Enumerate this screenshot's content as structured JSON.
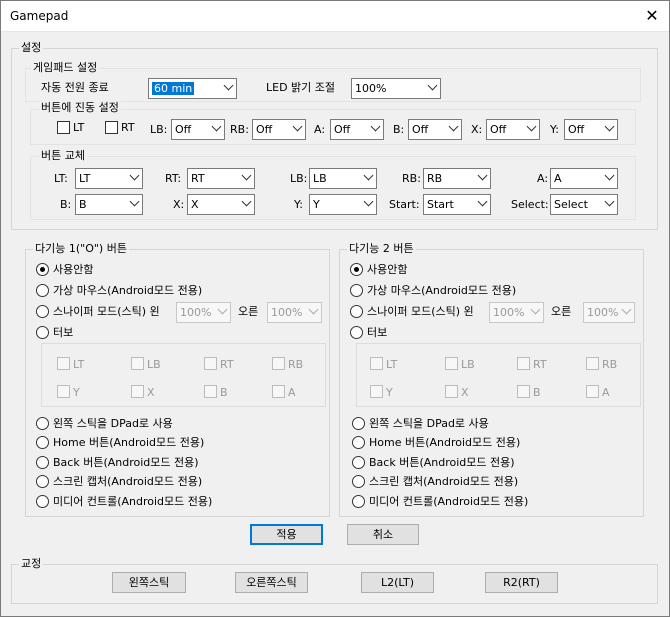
{
  "window": {
    "title": "Gamepad",
    "close_glyph": "✕"
  },
  "settings": {
    "legend": "설정",
    "gamepad": {
      "legend": "게임패드 설정",
      "auto_off_label": "자동 전원 종료",
      "auto_off_value": "60 min",
      "led_label": "LED 밝기 조절",
      "led_value": "100%"
    },
    "vibration": {
      "legend": "버튼에 진동 설정",
      "lt": "LT",
      "rt": "RT",
      "items": [
        {
          "label": "LB:",
          "value": "Off"
        },
        {
          "label": "RB:",
          "value": "Off"
        },
        {
          "label": "A:",
          "value": "Off"
        },
        {
          "label": "B:",
          "value": "Off"
        },
        {
          "label": "X:",
          "value": "Off"
        },
        {
          "label": "Y:",
          "value": "Off"
        }
      ]
    },
    "swap": {
      "legend": "버튼 교체",
      "row1": [
        {
          "label": "LT:",
          "value": "LT"
        },
        {
          "label": "RT:",
          "value": "RT"
        },
        {
          "label": "LB:",
          "value": "LB"
        },
        {
          "label": "RB:",
          "value": "RB"
        },
        {
          "label": "A:",
          "value": "A"
        }
      ],
      "row2": [
        {
          "label": "B:",
          "value": "B"
        },
        {
          "label": "X:",
          "value": "X"
        },
        {
          "label": "Y:",
          "value": "Y"
        },
        {
          "label": "Start:",
          "value": "Start"
        },
        {
          "label": "Select:",
          "value": "Select"
        }
      ]
    }
  },
  "multi1": {
    "legend": "다기능 1(\"O\") 버튼",
    "opt_none": "사용안함",
    "opt_mouse": "가상 마우스(Android모드 전용)",
    "opt_sniper": "스나이퍼 모드(스틱) 왼",
    "sniper_left": "100%",
    "sniper_right_label": "오른",
    "sniper_right": "100%",
    "opt_turbo": "터보",
    "turbo": [
      "LT",
      "LB",
      "RT",
      "RB",
      "Y",
      "X",
      "B",
      "A"
    ],
    "opt_dpad": "왼쪽 스틱을 DPad로 사용",
    "opt_home": "Home 버튼(Android모드 전용)",
    "opt_back": "Back 버튼(Android모드 전용)",
    "opt_capture": "스크린 캡처(Android모드 전용)",
    "opt_media": "미디어 컨트롤(Android모드 전용)"
  },
  "multi2": {
    "legend": "다기능 2 버튼",
    "opt_none": "사용안함",
    "opt_mouse": "가상 마우스(Android모드 전용)",
    "opt_sniper": "스나이퍼 모드(스틱) 왼",
    "sniper_left": "100%",
    "sniper_right_label": "오른",
    "sniper_right": "100%",
    "opt_turbo": "터보",
    "turbo": [
      "LT",
      "LB",
      "RT",
      "RB",
      "Y",
      "X",
      "B",
      "A"
    ],
    "opt_dpad": "왼쪽 스틱을 DPad로 사용",
    "opt_home": "Home 버튼(Android모드 전용)",
    "opt_back": "Back 버튼(Android모드 전용)",
    "opt_capture": "스크린 캡처(Android모드 전용)",
    "opt_media": "미디어 컨트롤(Android모드 전용)"
  },
  "actions": {
    "apply": "적용",
    "cancel": "취소"
  },
  "calibration": {
    "legend": "교정",
    "left_stick": "왼쪽스틱",
    "right_stick": "오른쪽스틱",
    "l2": "L2(LT)",
    "r2": "R2(RT)"
  }
}
